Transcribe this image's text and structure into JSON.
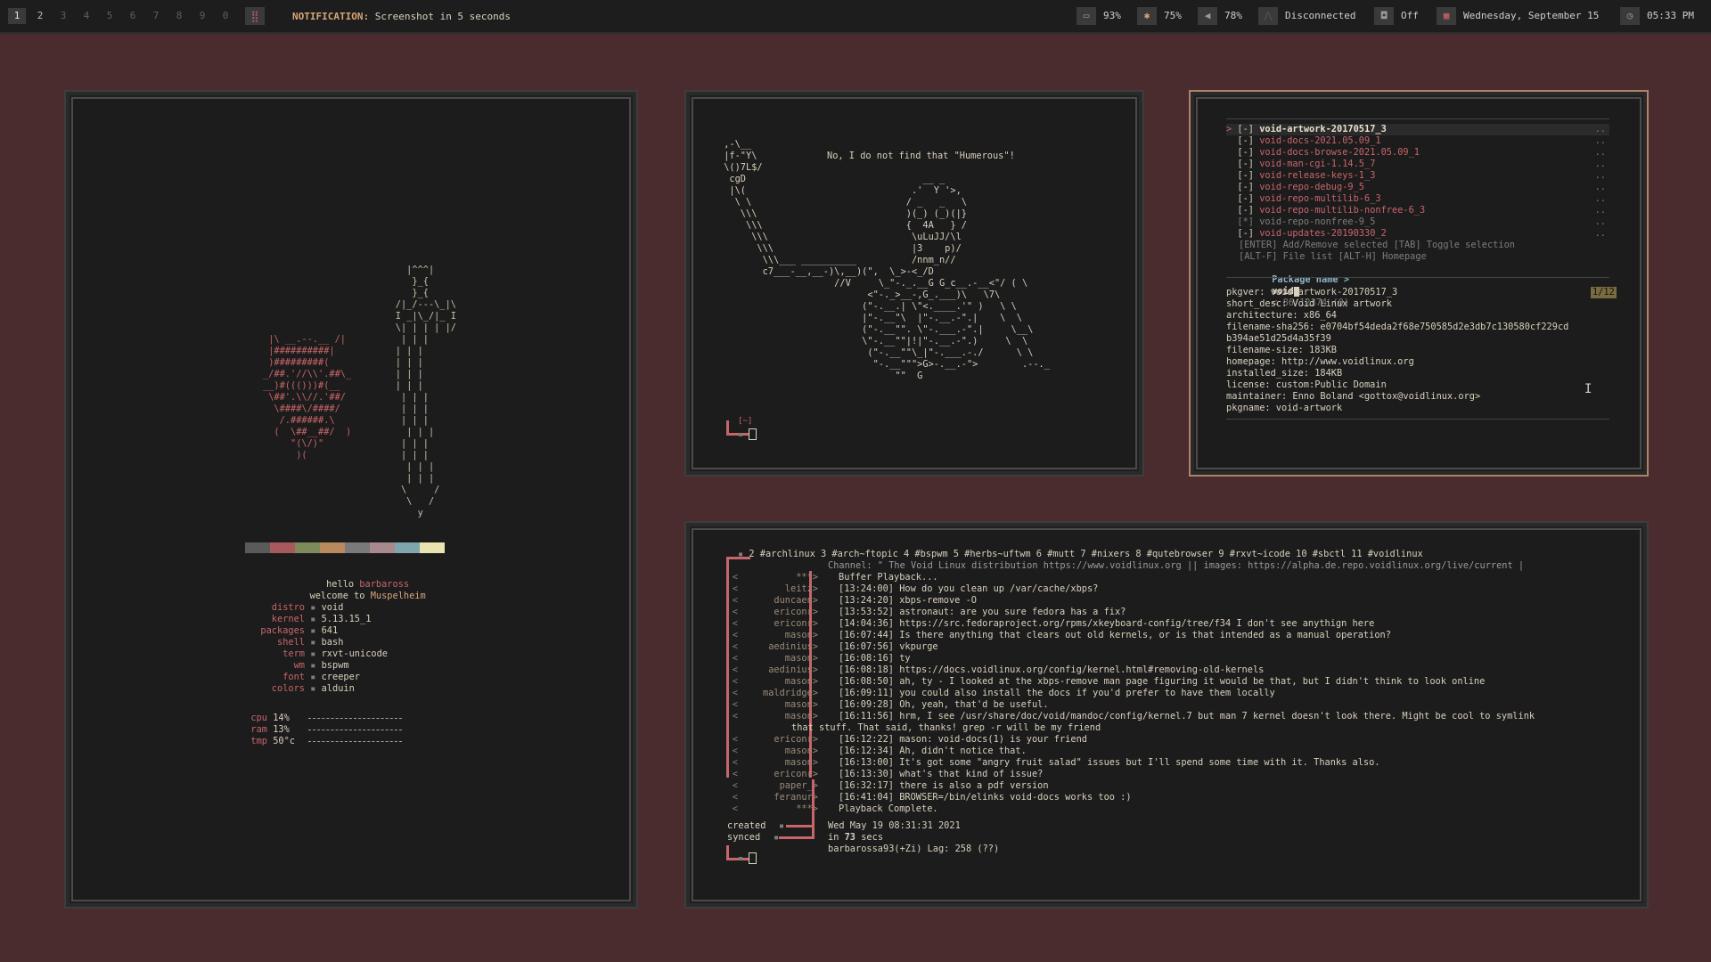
{
  "topbar": {
    "workspaces": [
      "1",
      "2",
      "3",
      "4",
      "5",
      "6",
      "7",
      "8",
      "9",
      "0"
    ],
    "grid_icon": "grid-icon",
    "notification_label": "NOTIFICATION:",
    "notification_text": "Screenshot in 5 seconds",
    "battery": "93%",
    "brightness": "75%",
    "volume": "78%",
    "network": "Disconnected",
    "vpn": "Off",
    "date": "Wednesday, September 15",
    "time": "05:33 PM"
  },
  "fetch": {
    "hello": "hello",
    "user": "barbaross",
    "welcome": "welcome to",
    "host": "Muspelheim",
    "rows": [
      {
        "k": "distro",
        "v": "void"
      },
      {
        "k": "kernel",
        "v": "5.13.15_1"
      },
      {
        "k": "packages",
        "v": "641"
      },
      {
        "k": "shell",
        "v": "bash"
      },
      {
        "k": "term",
        "v": "rxvt-unicode"
      },
      {
        "k": "wm",
        "v": "bspwm"
      },
      {
        "k": "font",
        "v": "creeper"
      },
      {
        "k": "colors",
        "v": "alduin"
      }
    ],
    "meters": [
      {
        "k": "cpu",
        "v": "14%"
      },
      {
        "k": "ram",
        "v": "13%"
      },
      {
        "k": "tmp",
        "v": "50°c"
      }
    ],
    "palette": [
      "#5a5a5a",
      "#a8595e",
      "#7f8a5a",
      "#b98a5e",
      "#7a7a7a",
      "#a88a8e",
      "#7fa6ad",
      "#e8e3b0"
    ]
  },
  "art": {
    "caption": "No, I do not find that \"Humerous\"!",
    "prompt_dir": "[~]"
  },
  "xbps": {
    "packages": [
      {
        "mark": "[-]",
        "name": "void-artwork-20170517_3"
      },
      {
        "mark": "[-]",
        "name": "void-docs-2021.05.09_1"
      },
      {
        "mark": "[-]",
        "name": "void-docs-browse-2021.05.09_1"
      },
      {
        "mark": "[-]",
        "name": "void-man-cgi-1.14.5_7"
      },
      {
        "mark": "[-]",
        "name": "void-release-keys-1_3"
      },
      {
        "mark": "[-]",
        "name": "void-repo-debug-9_5"
      },
      {
        "mark": "[-]",
        "name": "void-repo-multilib-6_3"
      },
      {
        "mark": "[-]",
        "name": "void-repo-multilib-nonfree-6_3"
      },
      {
        "mark": "[*]",
        "name": "void-repo-nonfree-9_5"
      },
      {
        "mark": "[-]",
        "name": "void-updates-20190330_2"
      }
    ],
    "help1": "[ENTER] Add/Remove selected [TAB] Toggle selection",
    "help2": "[ALT-F] File list [ALT-H] Homepage",
    "prompt_label": "Package name >",
    "query": "void",
    "count": "< 86/12374 (0)",
    "page": "1/12",
    "info": [
      "pkgver: void-artwork-20170517_3",
      "short_desc: Void Linux artwork",
      "architecture: x86_64",
      "filename-sha256: e0704bf54deda2f68e750585d2e3db7c130580cf229cd",
      "b394ae51d25d4a35f39",
      "filename-size: 183KB",
      "homepage: http://www.voidlinux.org",
      "installed_size: 184KB",
      "license: custom:Public Domain",
      "maintainer: Enno Boland <gottox@voidlinux.org>",
      "pkgname: void-artwork"
    ]
  },
  "irc": {
    "channels": "2 #archlinux 3 #arch~ftopic 4 #bspwm 5 #herbs~uftwm 6 #mutt 7 #nixers 8 #qutebrowser 9 #rxvt~icode 10 #sbctl 11 #voidlinux",
    "topic": "Channel: \" The Void Linux distribution https://www.voidlinux.org || images: https://alpha.de.repo.voidlinux.org/live/current |",
    "lines": [
      {
        "nick": "***>",
        "msg": "Buffer Playback..."
      },
      {
        "nick": "leitz>",
        "msg": "[13:24:00] How do you clean up /var/cache/xbps?"
      },
      {
        "nick": "duncaen>",
        "msg": "[13:24:20] xbps-remove -O"
      },
      {
        "nick": "ericonr>",
        "msg": "[13:53:52] astronaut: are you sure fedora has a fix?"
      },
      {
        "nick": "ericonr>",
        "msg": "[14:04:36] https://src.fedoraproject.org/rpms/xkeyboard-config/tree/f34 I don't see anythign here"
      },
      {
        "nick": "mason>",
        "msg": "[16:07:44] Is there anything that clears out old kernels, or is that intended as a manual operation?"
      },
      {
        "nick": "aedinius>",
        "msg": "[16:07:56] vkpurge"
      },
      {
        "nick": "mason>",
        "msg": "[16:08:16] ty"
      },
      {
        "nick": "aedinius>",
        "msg": "[16:08:18] https://docs.voidlinux.org/config/kernel.html#removing-old-kernels"
      },
      {
        "nick": "mason>",
        "msg": "[16:08:50] ah, ty - I looked at the xbps-remove man page figuring it would be that, but I didn't think to look online"
      },
      {
        "nick": "maldridge>",
        "msg": "[16:09:11] you could also install the docs if you'd prefer to have them locally"
      },
      {
        "nick": "mason>",
        "msg": "[16:09:28] Oh, yeah, that'd be useful."
      },
      {
        "nick": "mason>",
        "msg": "[16:11:56] hrm, I see /usr/share/doc/void/mandoc/config/kernel.7 but man 7 kernel doesn't look there. Might be cool to symlink"
      },
      {
        "nick": "",
        "msg": "that stuff. That said, thanks! grep -r will be my friend"
      },
      {
        "nick": "ericonr>",
        "msg": "[16:12:22] mason: void-docs(1) is your friend"
      },
      {
        "nick": "mason>",
        "msg": "[16:12:34] Ah, didn't notice that."
      },
      {
        "nick": "mason>",
        "msg": "[16:13:00] It's got some \"angry fruit salad\" issues but I'll spend some time with it. Thanks also."
      },
      {
        "nick": "ericonr>",
        "msg": "[16:13:30] what's that kind of issue?"
      },
      {
        "nick": "paper_>",
        "msg": "[16:32:17] there is also a pdf version"
      },
      {
        "nick": "feranur>",
        "msg": "[16:41:04] BROWSER=/bin/elinks void-docs works too :)"
      },
      {
        "nick": "***>",
        "msg": "Playback Complete."
      }
    ],
    "created_label": "created",
    "created_val": "Wed May 19 08:31:31 2021",
    "synced_label": "synced",
    "synced_val_pre": "in",
    "synced_val_num": "73",
    "synced_val_post": "secs",
    "status": "barbarossa93(+Zi) Lag: 258 (??)"
  }
}
